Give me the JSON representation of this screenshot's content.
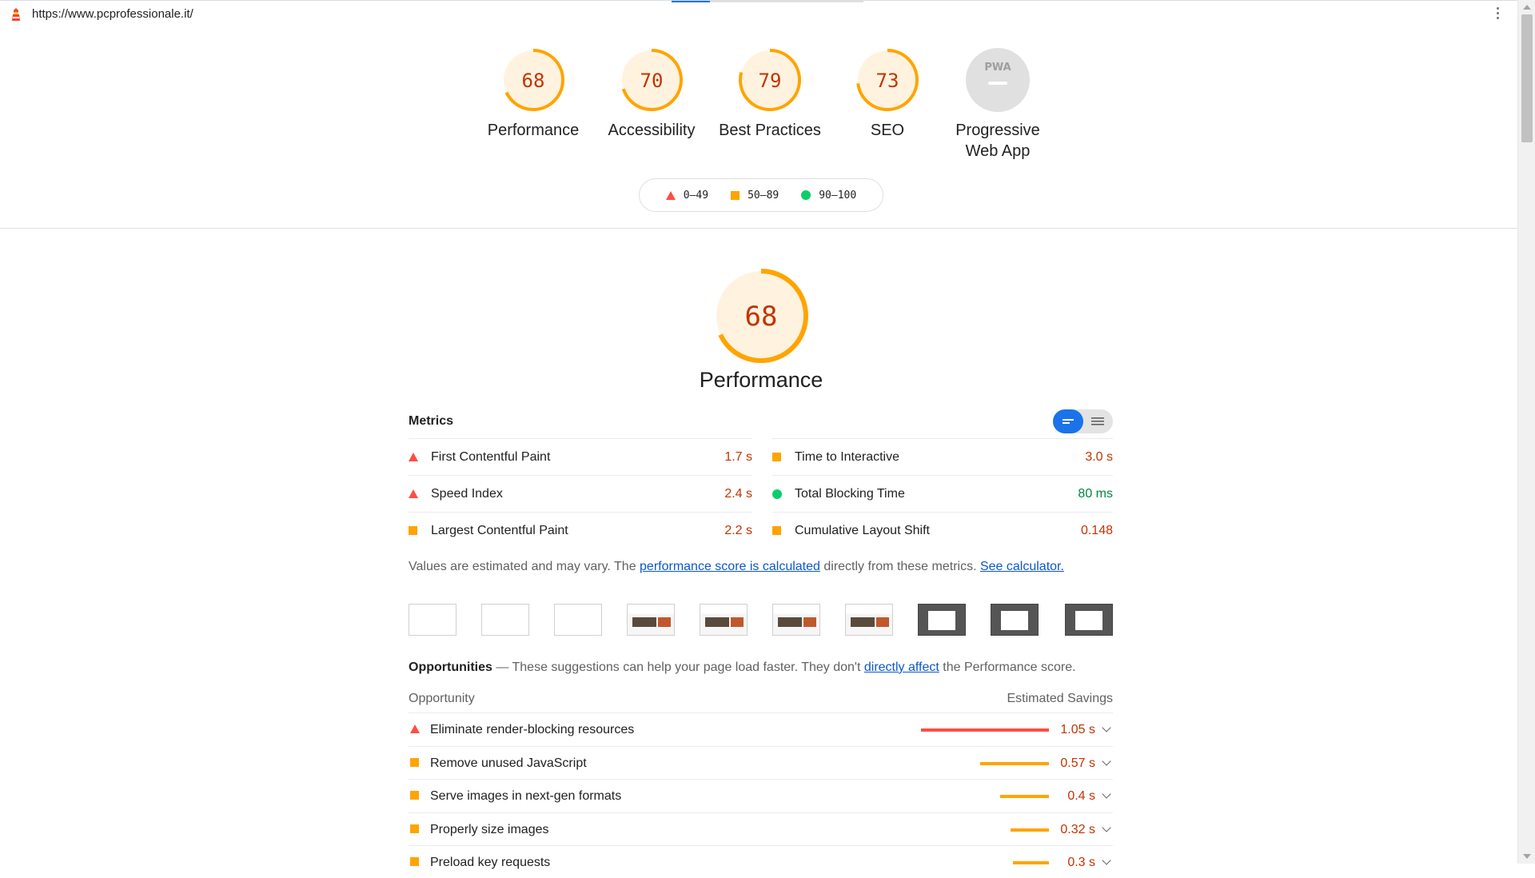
{
  "browser": {
    "url": "https://www.pcprofessionale.it/"
  },
  "categories": [
    {
      "score": "68",
      "label": "Performance",
      "fraction": 0.68
    },
    {
      "score": "70",
      "label": "Accessibility",
      "fraction": 0.7
    },
    {
      "score": "79",
      "label": "Best Practices",
      "fraction": 0.79
    },
    {
      "score": "73",
      "label": "SEO",
      "fraction": 0.73
    }
  ],
  "pwa": {
    "badge": "PWA",
    "label_line1": "Progressive",
    "label_line2": "Web App"
  },
  "legend": {
    "fail": "0–49",
    "average": "50–89",
    "pass": "90–100"
  },
  "colors": {
    "fail": "#ff4e42",
    "average": "#ffa400",
    "pass": "#0cce6b",
    "link": "#0b57d0"
  },
  "performance": {
    "score": "68",
    "fraction": 0.68,
    "title": "Performance",
    "metrics_label": "Metrics",
    "metrics": [
      {
        "name": "First Contentful Paint",
        "value": "1.7 s",
        "rating": "fail"
      },
      {
        "name": "Time to Interactive",
        "value": "3.0 s",
        "rating": "average"
      },
      {
        "name": "Speed Index",
        "value": "2.4 s",
        "rating": "fail"
      },
      {
        "name": "Total Blocking Time",
        "value": "80 ms",
        "rating": "pass"
      },
      {
        "name": "Largest Contentful Paint",
        "value": "2.2 s",
        "rating": "average"
      },
      {
        "name": "Cumulative Layout Shift",
        "value": "0.148",
        "rating": "average"
      }
    ],
    "note_prefix": "Values are estimated and may vary. The ",
    "note_link1": "performance score is calculated",
    "note_mid": " directly from these metrics. ",
    "note_link2": "See calculator."
  },
  "opportunities": {
    "heading": "Opportunities",
    "heading_desc_prefix": " — These suggestions can help your page load faster. They don't ",
    "heading_link": "directly affect",
    "heading_desc_suffix": " the Performance score.",
    "col_opportunity": "Opportunity",
    "col_savings": "Estimated Savings",
    "items": [
      {
        "name": "Eliminate render-blocking resources",
        "savings": "1.05 s",
        "rating": "fail",
        "fraction": 1.0
      },
      {
        "name": "Remove unused JavaScript",
        "savings": "0.57 s",
        "rating": "average",
        "fraction": 0.54
      },
      {
        "name": "Serve images in next-gen formats",
        "savings": "0.4 s",
        "rating": "average",
        "fraction": 0.38
      },
      {
        "name": "Properly size images",
        "savings": "0.32 s",
        "rating": "average",
        "fraction": 0.3
      },
      {
        "name": "Preload key requests",
        "savings": "0.3 s",
        "rating": "average",
        "fraction": 0.28
      }
    ]
  }
}
